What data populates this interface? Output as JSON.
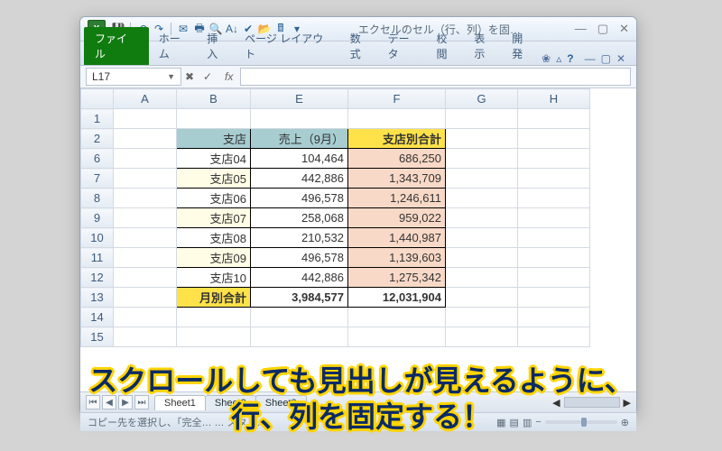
{
  "title": "エクセルのセル（行、列）を固…",
  "qat_icons": [
    "save",
    "sep",
    "undo",
    "redo",
    "sep",
    "mail",
    "quickprint",
    "preview",
    "sort",
    "spellcheck",
    "open",
    "calc",
    "dropdown"
  ],
  "ribbon": {
    "file_label": "ファイル",
    "tabs": [
      "ホーム",
      "挿入",
      "ページ レイアウト",
      "数式",
      "データ",
      "校閲",
      "表示",
      "開発"
    ],
    "active_index": -1,
    "addin_glyph": "❀"
  },
  "namebox": "L17",
  "formula": "",
  "columns": [
    "",
    "A",
    "B",
    "E",
    "F",
    "G",
    "H"
  ],
  "row_headers": [
    "1",
    "2",
    "6",
    "7",
    "8",
    "9",
    "10",
    "11",
    "12",
    "13",
    "14",
    "15"
  ],
  "header_row": {
    "B": "支店",
    "E": "売上（9月）",
    "F": "支店別合計"
  },
  "data_rows": [
    {
      "B": "支店04",
      "E": "104,464",
      "F": "686,250",
      "alt": false
    },
    {
      "B": "支店05",
      "E": "442,886",
      "F": "1,343,709",
      "alt": true
    },
    {
      "B": "支店06",
      "E": "496,578",
      "F": "1,246,611",
      "alt": false
    },
    {
      "B": "支店07",
      "E": "258,068",
      "F": "959,022",
      "alt": true
    },
    {
      "B": "支店08",
      "E": "210,532",
      "F": "1,440,987",
      "alt": false
    },
    {
      "B": "支店09",
      "E": "496,578",
      "F": "1,139,603",
      "alt": true
    },
    {
      "B": "支店10",
      "E": "442,886",
      "F": "1,275,342",
      "alt": false
    }
  ],
  "total_row": {
    "B": "月別合計",
    "E": "3,984,577",
    "F": "12,031,904"
  },
  "sheet_tabs": [
    "Sheet1",
    "Sheet2",
    "Sheet3"
  ],
  "status_text": "コピー先を選択し、「完全… … スタン…",
  "status_right": "⊕",
  "overlay_line1": "スクロールしても見出しが見えるように、",
  "overlay_line2": "行、列を固定する！"
}
